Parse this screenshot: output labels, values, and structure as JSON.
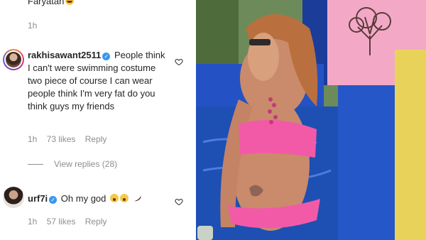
{
  "top_comment": {
    "text_fragment": "Faryatan",
    "time": "1h"
  },
  "comments": [
    {
      "username": "rakhisawant2511",
      "verified": true,
      "text": "People think I can't were swimming costume two piece of course I can wear people think I'm very fat do you think guys my friends",
      "time": "1h",
      "likes": "73 likes",
      "reply_label": "Reply",
      "view_replies": "View replies (28)"
    },
    {
      "username": "urf7i",
      "verified": true,
      "text": "Oh my god",
      "emojis": [
        "astonished-face",
        "astonished-face",
        "pepper"
      ],
      "time": "1h",
      "likes": "57 likes",
      "reply_label": "Reply"
    }
  ],
  "colors": {
    "verified_blue": "#3897f0",
    "meta_gray": "#8e8e8e",
    "text": "#262626",
    "bikini_pink": "#f25aa8",
    "wall_pink": "#f3a9c6",
    "pool_blue": "#1e4fb3"
  }
}
